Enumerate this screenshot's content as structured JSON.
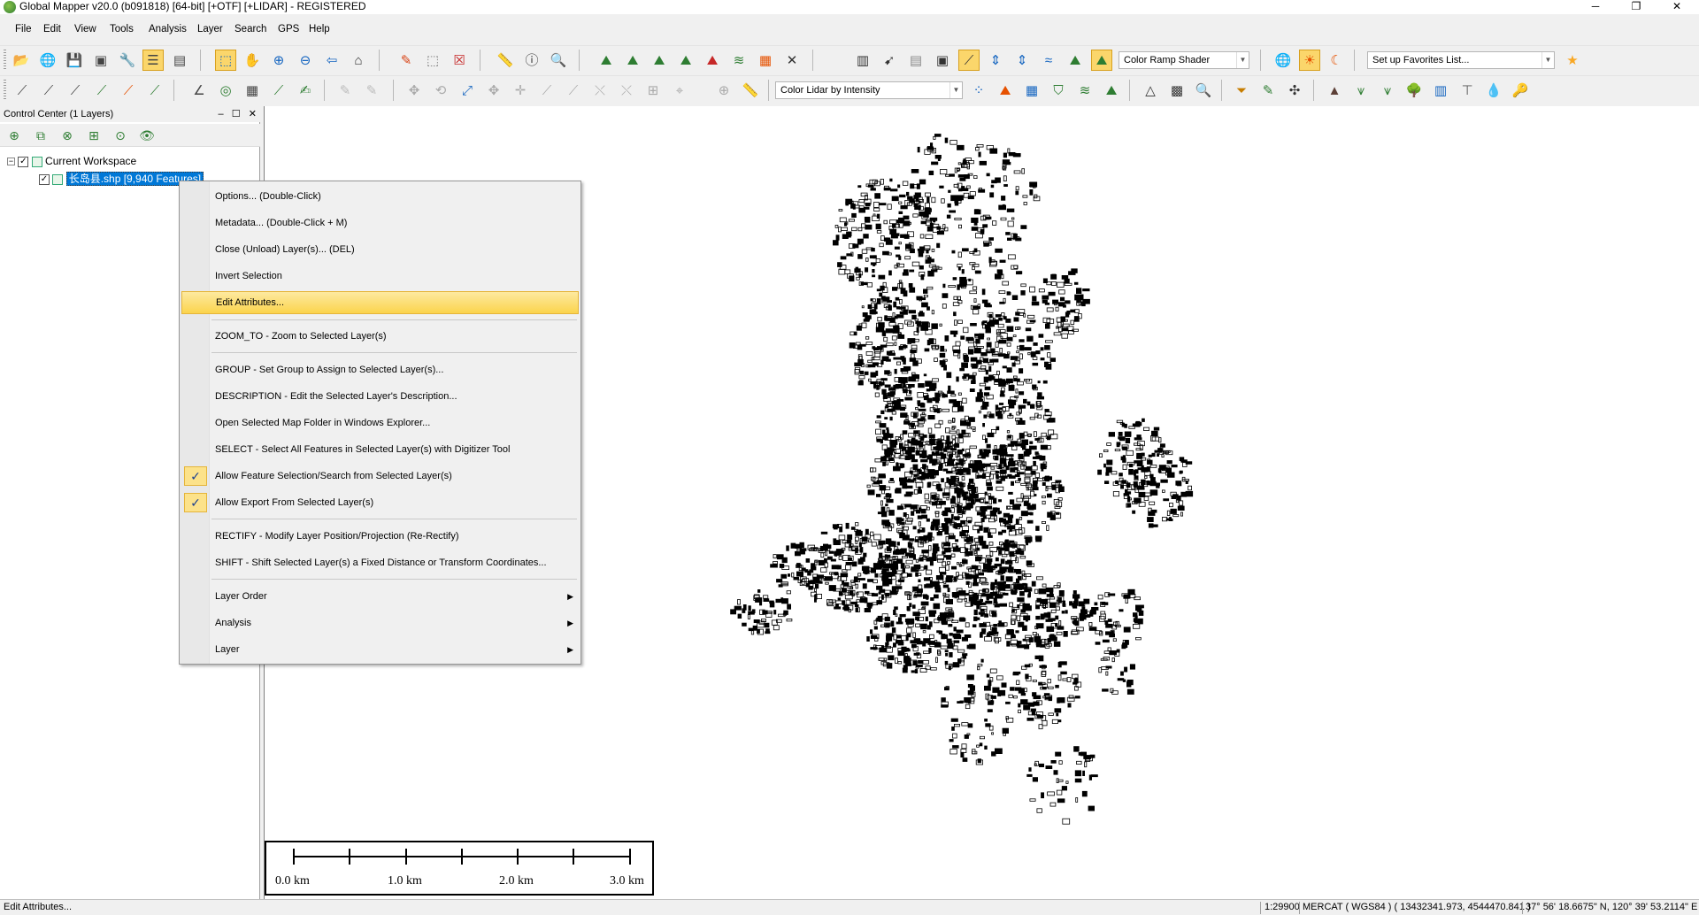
{
  "window": {
    "title": "Global Mapper v20.0 (b091818) [64-bit] [+OTF] [+LIDAR] - REGISTERED",
    "minimize": "─",
    "restore": "❐",
    "close": "✕"
  },
  "menubar": [
    "File",
    "Edit",
    "View",
    "Tools",
    "Analysis",
    "Layer",
    "Search",
    "GPS",
    "Help"
  ],
  "toolbar": {
    "shader_select": "Color Ramp Shader",
    "favorites_select": "Set up Favorites List...",
    "lidar_color_select": "Color Lidar by Intensity"
  },
  "control_center": {
    "title": "Control Center (1 Layers)",
    "ctrl_min": "–",
    "ctrl_max": "☐",
    "ctrl_close": "✕",
    "workspace": "Current Workspace",
    "layer": "长岛县.shp [9,940 Features]"
  },
  "context_menu": {
    "items": [
      {
        "label": "Options... (Double-Click)"
      },
      {
        "label": "Metadata... (Double-Click + M)"
      },
      {
        "label": "Close (Unload) Layer(s)... (DEL)"
      },
      {
        "label": "Invert Selection"
      },
      {
        "label": "Edit Attributes...",
        "highlighted": true
      },
      {
        "label": "ZOOM_TO - Zoom to Selected Layer(s)"
      },
      {
        "label": "GROUP - Set Group to Assign to Selected Layer(s)..."
      },
      {
        "label": "DESCRIPTION - Edit the Selected Layer's Description..."
      },
      {
        "label": "Open Selected Map Folder in Windows Explorer..."
      },
      {
        "label": "SELECT - Select All Features in Selected Layer(s) with Digitizer Tool"
      },
      {
        "label": "Allow Feature Selection/Search from Selected Layer(s)",
        "checked": true
      },
      {
        "label": "Allow Export From Selected Layer(s)",
        "checked": true
      },
      {
        "label": "RECTIFY - Modify Layer Position/Projection (Re-Rectify)"
      },
      {
        "label": "SHIFT - Shift Selected Layer(s) a Fixed Distance or Transform Coordinates..."
      },
      {
        "label": "Layer Order",
        "submenu": true
      },
      {
        "label": "Analysis",
        "submenu": true
      },
      {
        "label": "Layer",
        "submenu": true
      }
    ],
    "check_glyph": "✓",
    "submenu_glyph": "▶"
  },
  "scalebar": {
    "labels": [
      "0.0 km",
      "1.0 km",
      "2.0 km",
      "3.0 km"
    ]
  },
  "statusbar": {
    "message": "Edit Attributes...",
    "scale": "1:29900",
    "projection": "MERCAT ( WGS84 ) ( 13432341.973, 4544470.841 )",
    "coords": "37° 56' 18.6675\" N, 120° 39' 53.2114\" E"
  }
}
